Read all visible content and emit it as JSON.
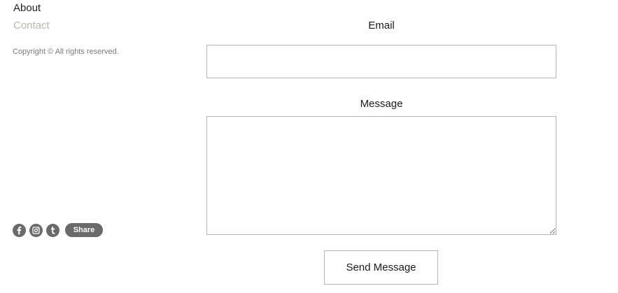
{
  "nav": {
    "items": [
      {
        "label": "About"
      },
      {
        "label": "Contact"
      }
    ]
  },
  "footer": {
    "copyright": "Copyright © All rights reserved.",
    "social": {
      "icons": [
        "facebook-icon",
        "instagram-icon",
        "tumblr-icon"
      ],
      "share_label": "Share"
    }
  },
  "form": {
    "email_label": "Email",
    "email_value": "",
    "message_label": "Message",
    "message_value": "",
    "submit_label": "Send Message"
  },
  "colors": {
    "active_nav": "#222222",
    "inactive_nav": "#b8b8b0",
    "social_bg": "#6a6a6a",
    "border": "#b5b5b5"
  }
}
